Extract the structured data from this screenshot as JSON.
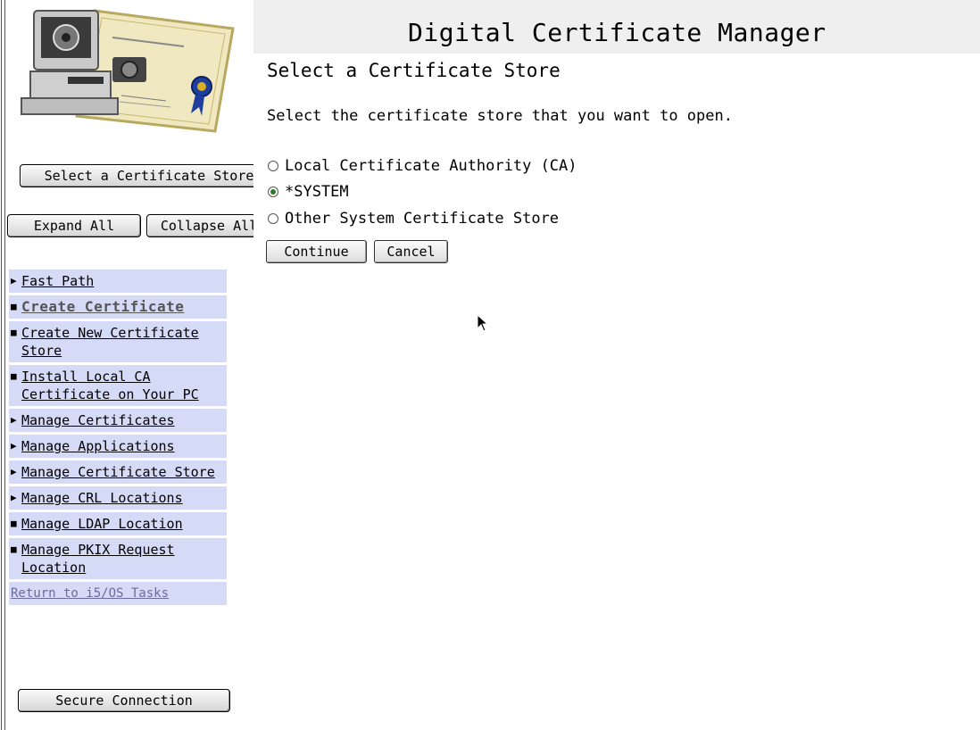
{
  "app": {
    "title": "Digital Certificate Manager"
  },
  "nav": {
    "select_certificate_store_button": "Select a Certificate Store",
    "expand_all_button": "Expand All",
    "collapse_all_button": "Collapse All",
    "tasks": [
      {
        "label": "Fast Path",
        "bullet": "▶"
      },
      {
        "label": "Create Certificate",
        "bullet": "■"
      },
      {
        "label": "Create New Certificate Store",
        "bullet": "■"
      },
      {
        "label": "Install Local CA Certificate on Your PC",
        "bullet": "■"
      },
      {
        "label": "Manage Certificates",
        "bullet": "▶"
      },
      {
        "label": "Manage Applications",
        "bullet": "▶"
      },
      {
        "label": "Manage Certificate Store",
        "bullet": "▶"
      },
      {
        "label": "Manage CRL Locations",
        "bullet": "▶"
      },
      {
        "label": "Manage LDAP Location",
        "bullet": "■"
      },
      {
        "label": "Manage PKIX Request Location",
        "bullet": "■"
      }
    ],
    "return_link": "Return to i5/OS Tasks",
    "secure_connection_button": "Secure Connection"
  },
  "main": {
    "heading": "Select a Certificate Store",
    "instructions": "Select the certificate store that you want to open.",
    "options": [
      {
        "label": "Local Certificate Authority (CA)",
        "selected": false
      },
      {
        "label": "*SYSTEM",
        "selected": true
      },
      {
        "label": "Other System Certificate Store",
        "selected": false
      }
    ],
    "continue_button": "Continue",
    "cancel_button": "Cancel"
  },
  "colors": {
    "nav_item_bg": "#d5daf7",
    "header_bg": "#efefef"
  }
}
